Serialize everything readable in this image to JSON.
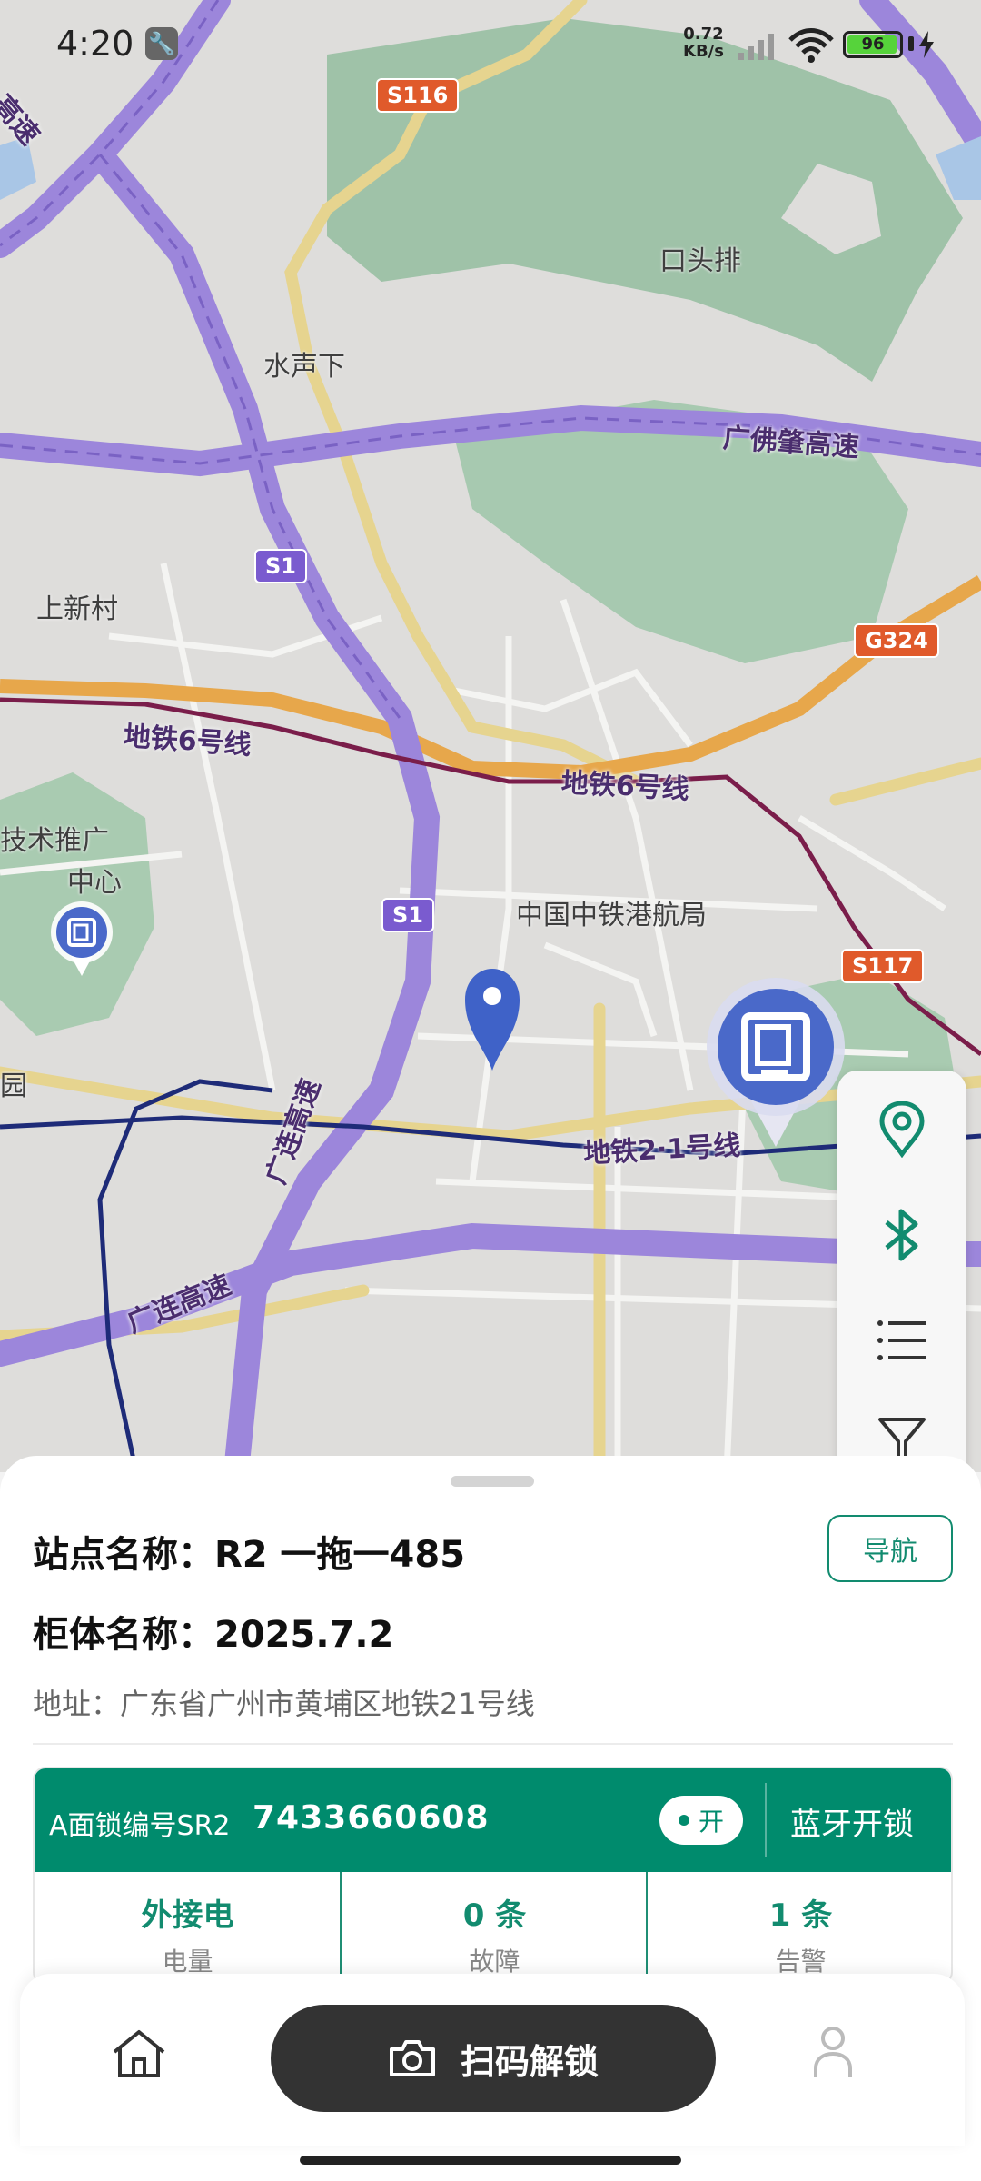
{
  "status_bar": {
    "time": "4:20",
    "net_speed_value": "0.72",
    "net_speed_unit": "KB/s",
    "battery_level": "96",
    "battery_percent": 96
  },
  "map": {
    "place_labels": [
      "口头排",
      "水声下",
      "上新村",
      "中国中铁港航局",
      "技术推广",
      "中心",
      "园"
    ],
    "road_labels": [
      "广佛肇高速",
      "地铁6号线",
      "地铁6号线",
      "地铁2·1号线",
      "广连高速",
      "广连高速",
      "高速"
    ],
    "shields": [
      "S116",
      "S1",
      "S1",
      "G324",
      "S117"
    ],
    "icons": {
      "station_marker": "cabinet-marker-icon",
      "location_pin": "location-pin-icon"
    }
  },
  "map_toolbar": {
    "icons": [
      "location-icon",
      "bluetooth-icon",
      "list-icon",
      "filter-icon"
    ]
  },
  "sheet": {
    "station_name": "站点名称：R2 一拖一485",
    "navigate_label": "导航",
    "cabinet_name": "柜体名称：2025.7.2",
    "address": "地址：广东省广州市黄埔区地铁21号线",
    "lock": {
      "label": "A面锁编号SR2",
      "number": "7433660608",
      "toggle_label": "开",
      "bluetooth_unlock": "蓝牙开锁"
    },
    "stats": [
      {
        "value": "外接电",
        "label": "电量"
      },
      {
        "value": "0 条",
        "label": "故障"
      },
      {
        "value": "1 条",
        "label": "告警"
      }
    ]
  },
  "bottom_nav": {
    "scan_label": "扫码解锁"
  },
  "colors": {
    "brand_green": "#008b6d",
    "accent_green": "#128b6f",
    "dark_button": "#333333"
  }
}
